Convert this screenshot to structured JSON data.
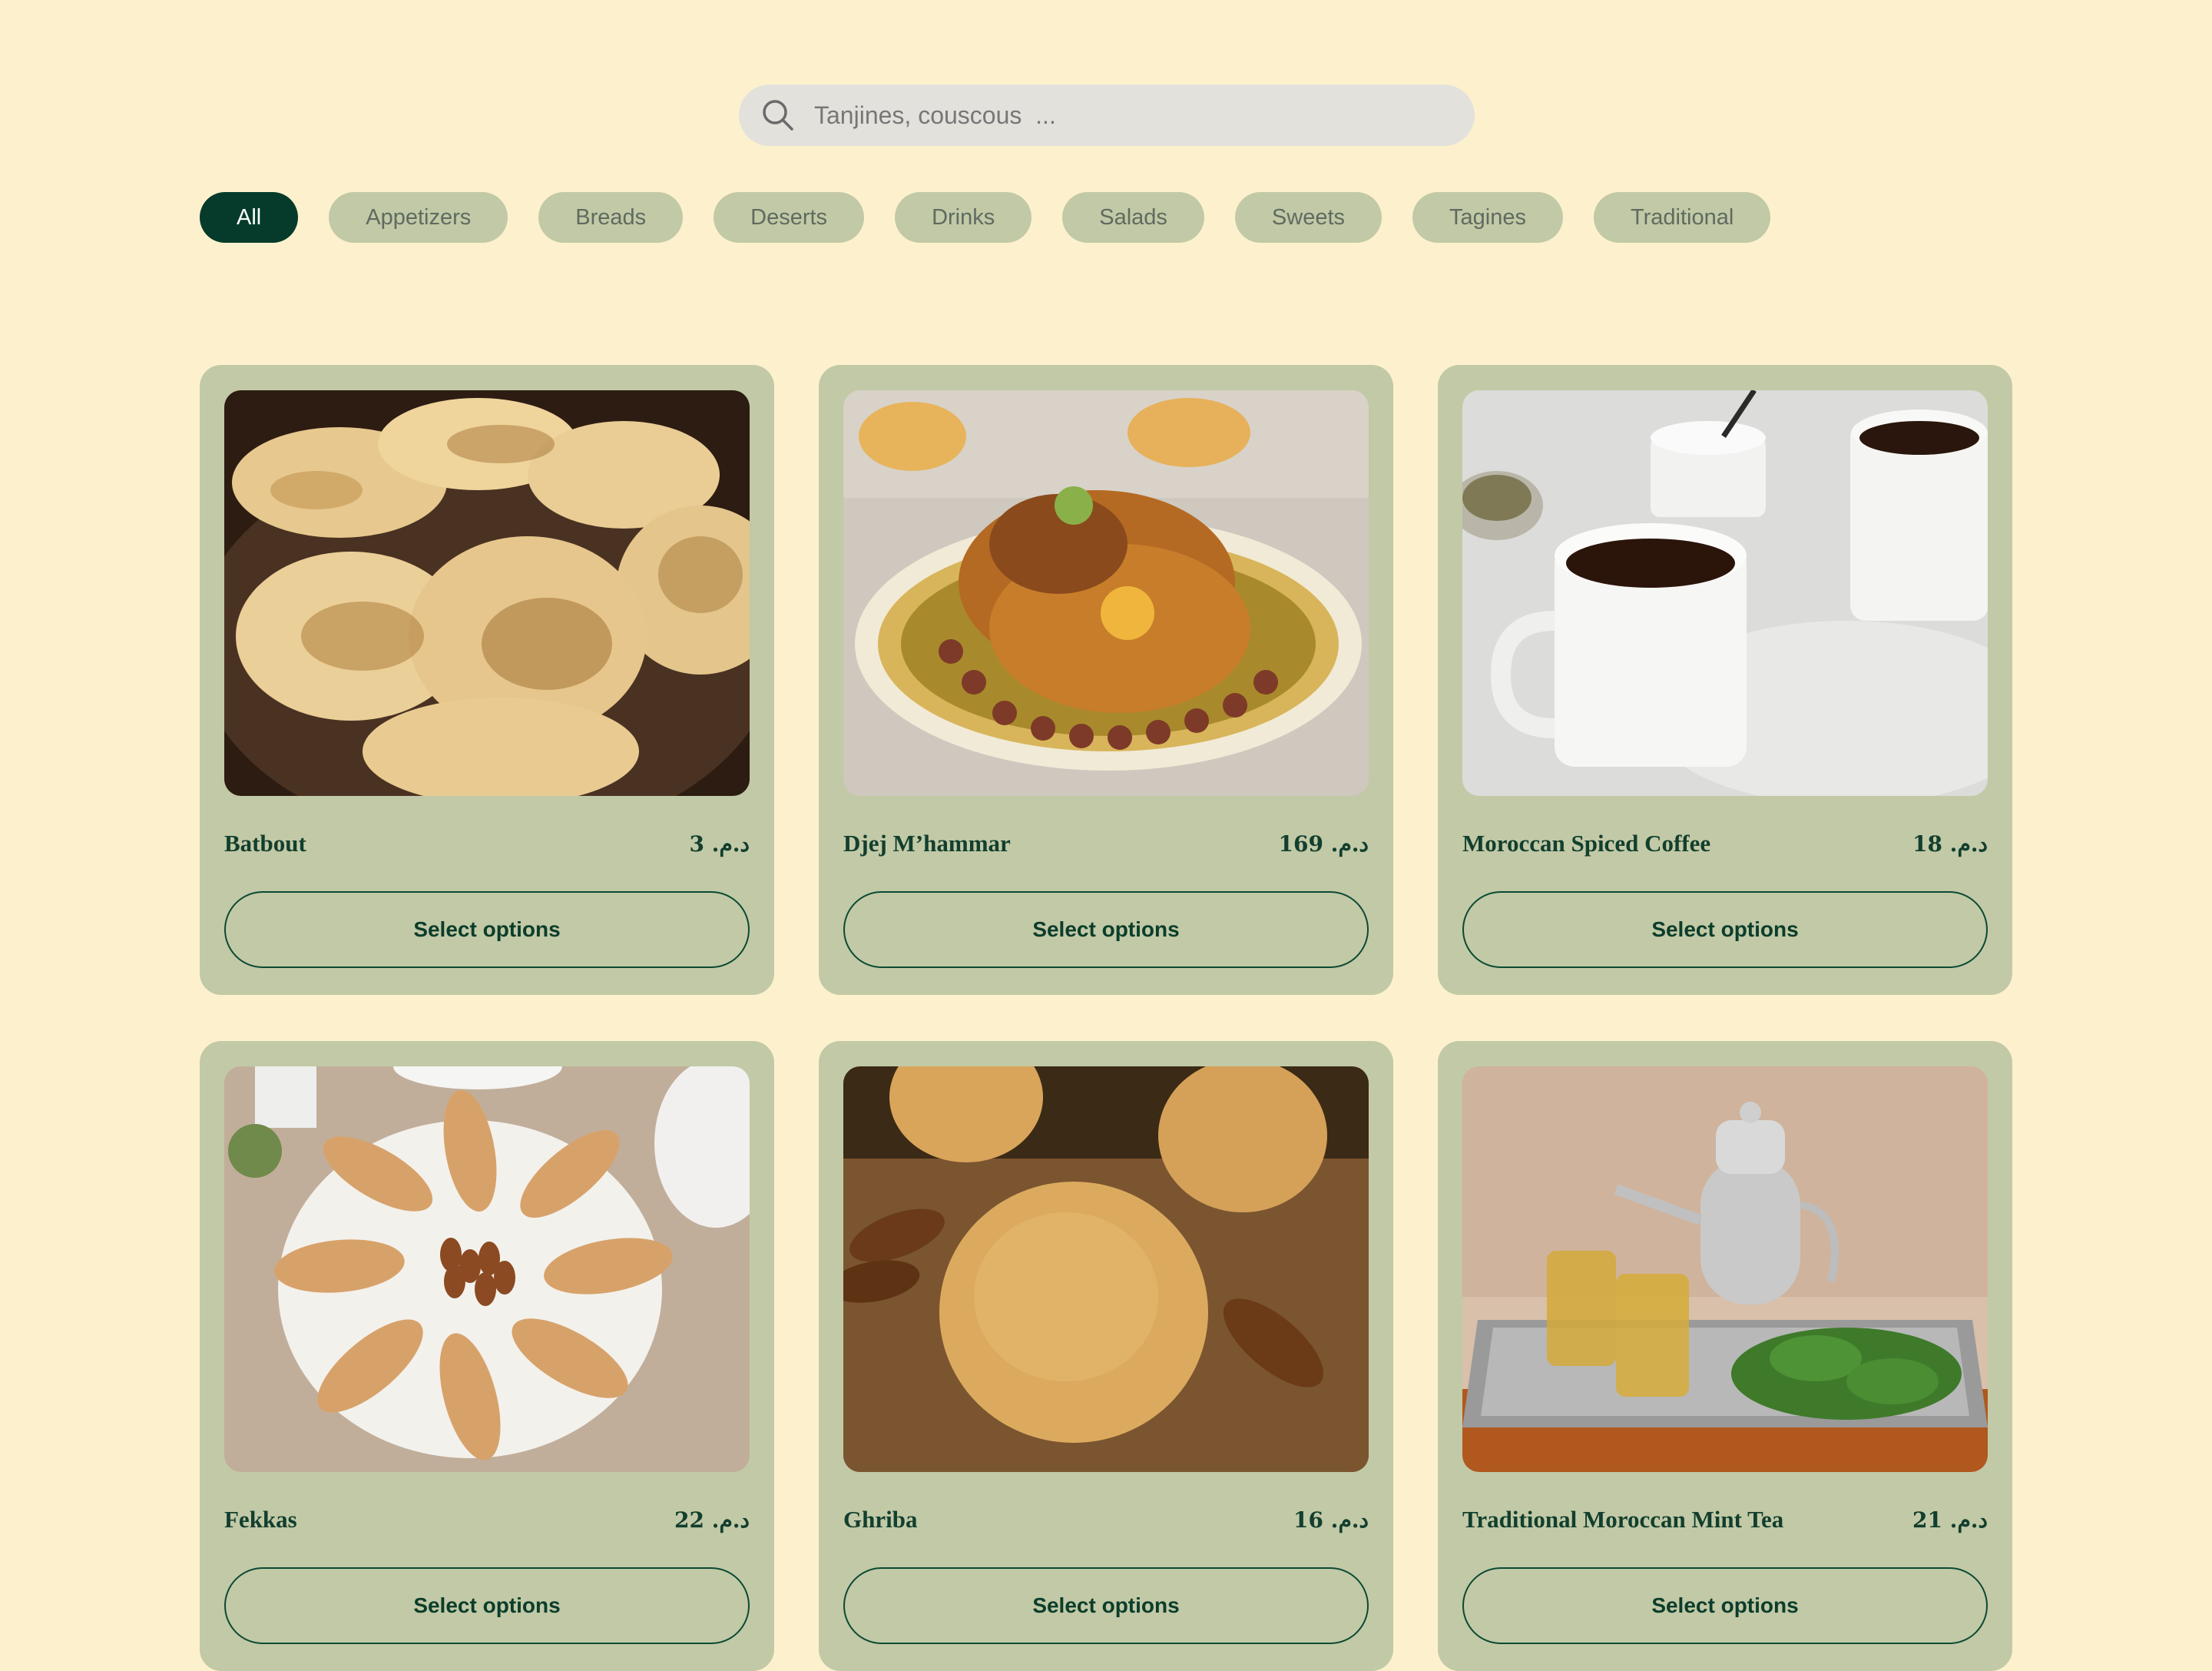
{
  "search": {
    "placeholder": "Tanjines, couscous  ..."
  },
  "filters": [
    {
      "label": "All",
      "active": true
    },
    {
      "label": "Appetizers",
      "active": false
    },
    {
      "label": "Breads",
      "active": false
    },
    {
      "label": "Deserts",
      "active": false
    },
    {
      "label": "Drinks",
      "active": false
    },
    {
      "label": "Salads",
      "active": false
    },
    {
      "label": "Sweets",
      "active": false
    },
    {
      "label": "Tagines",
      "active": false
    },
    {
      "label": "Traditional",
      "active": false
    }
  ],
  "products": [
    {
      "name": "Batbout",
      "price": "3 .د.م",
      "button": "Select options"
    },
    {
      "name": "Djej M’hammar",
      "price": "169 .د.م",
      "button": "Select options"
    },
    {
      "name": "Moroccan Spiced Coffee",
      "price": "18 .د.م",
      "button": "Select options"
    },
    {
      "name": "Fekkas",
      "price": "22 .د.م",
      "button": "Select options"
    },
    {
      "name": "Ghriba",
      "price": "16 .د.م",
      "button": "Select options"
    },
    {
      "name": "Traditional Moroccan Mint Tea",
      "price": "21 .د.م",
      "button": "Select options"
    }
  ],
  "colors": {
    "background": "#fdf1cd",
    "card": "#c2c9a6",
    "accent": "#063b2b"
  }
}
